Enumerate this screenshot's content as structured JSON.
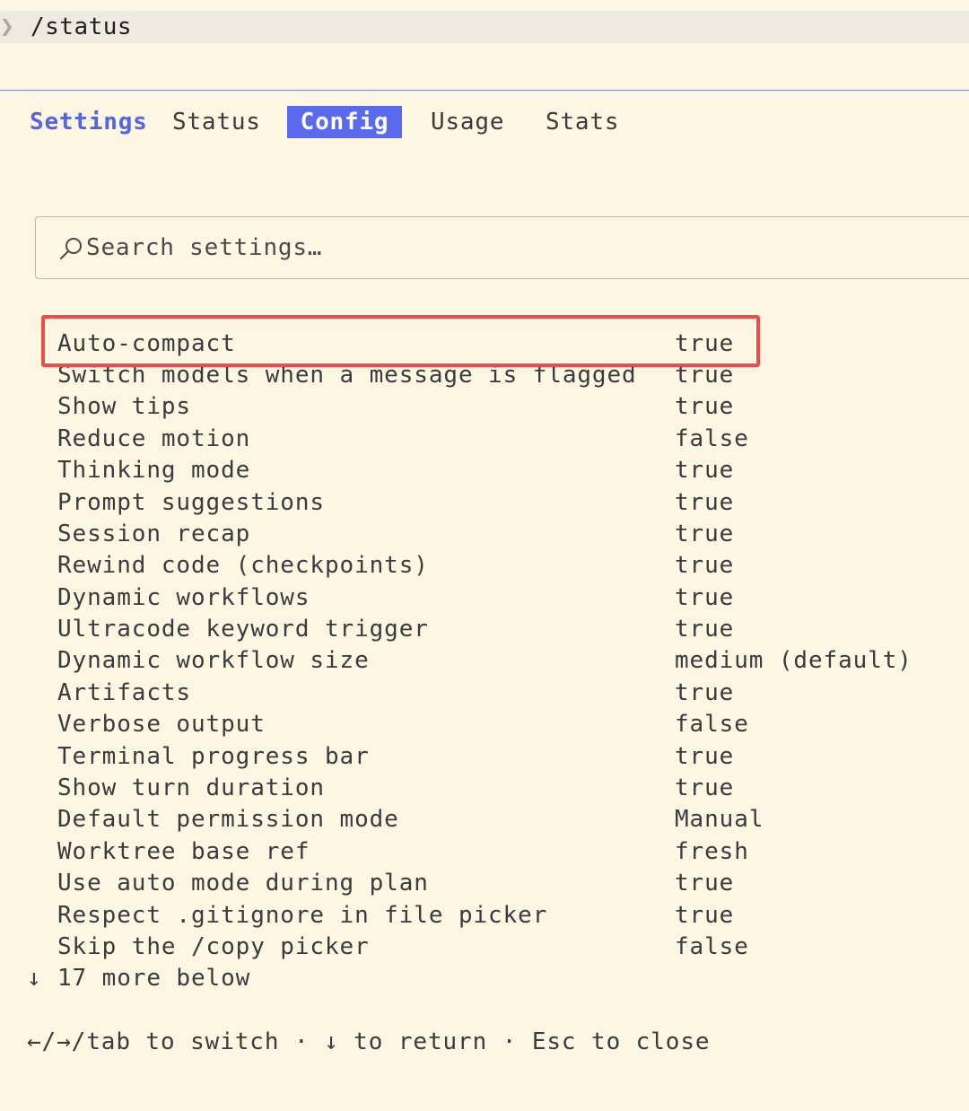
{
  "command": {
    "prompt_glyph": "❯",
    "text": "/status"
  },
  "tabs": [
    {
      "label": "Settings"
    },
    {
      "label": "Status"
    },
    {
      "label": "Config"
    },
    {
      "label": "Usage"
    },
    {
      "label": "Stats"
    }
  ],
  "active_tab": "Config",
  "search": {
    "placeholder": "Search settings…",
    "value": ""
  },
  "settings": [
    {
      "label": "Auto-compact",
      "value": "true"
    },
    {
      "label": "Switch models when a message is flagged",
      "value": "true"
    },
    {
      "label": "Show tips",
      "value": "true"
    },
    {
      "label": "Reduce motion",
      "value": "false"
    },
    {
      "label": "Thinking mode",
      "value": "true"
    },
    {
      "label": "Prompt suggestions",
      "value": "true"
    },
    {
      "label": "Session recap",
      "value": "true"
    },
    {
      "label": "Rewind code (checkpoints)",
      "value": "true"
    },
    {
      "label": "Dynamic workflows",
      "value": "true"
    },
    {
      "label": "Ultracode keyword trigger",
      "value": "true"
    },
    {
      "label": "Dynamic workflow size",
      "value": "medium (default)"
    },
    {
      "label": "Artifacts",
      "value": "true"
    },
    {
      "label": "Verbose output",
      "value": "false"
    },
    {
      "label": "Terminal progress bar",
      "value": "true"
    },
    {
      "label": "Show turn duration",
      "value": "true"
    },
    {
      "label": "Default permission mode",
      "value": "Manual"
    },
    {
      "label": "Worktree base ref",
      "value": "fresh"
    },
    {
      "label": "Use auto mode during plan",
      "value": "true"
    },
    {
      "label": "Respect .gitignore in file picker",
      "value": "true"
    },
    {
      "label": "Skip the /copy picker",
      "value": "false"
    }
  ],
  "more_below": {
    "arrow": "↓",
    "text": "17 more below"
  },
  "footer_hint": "←/→/tab to switch · ↓ to return · Esc to close",
  "colors": {
    "background": "#fdf6e3",
    "accent": "#5a6aef",
    "highlight_border": "#ef4b4b"
  }
}
